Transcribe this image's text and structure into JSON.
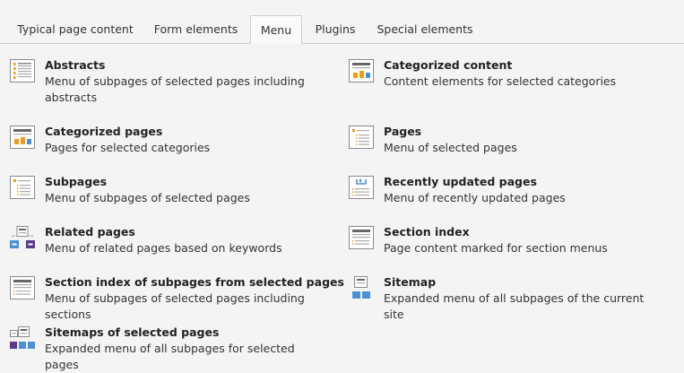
{
  "tabs": [
    {
      "label": "Typical page content"
    },
    {
      "label": "Form elements"
    },
    {
      "label": "Menu"
    },
    {
      "label": "Plugins"
    },
    {
      "label": "Special elements"
    }
  ],
  "active_tab": "Menu",
  "items": [
    {
      "title": "Abstracts",
      "desc": "Menu of subpages of selected pages including abstracts",
      "icon": "menu-abstracts-icon"
    },
    {
      "title": "Categorized content",
      "desc": "Content elements for selected categories",
      "icon": "categorized-content-icon"
    },
    {
      "title": "Categorized pages",
      "desc": "Pages for selected categories",
      "icon": "categorized-pages-icon"
    },
    {
      "title": "Pages",
      "desc": "Menu of selected pages",
      "icon": "menu-pages-icon"
    },
    {
      "title": "Subpages",
      "desc": "Menu of subpages of selected pages",
      "icon": "menu-subpages-icon"
    },
    {
      "title": "Recently updated pages",
      "desc": "Menu of recently updated pages",
      "icon": "recently-updated-icon"
    },
    {
      "title": "Related pages",
      "desc": "Menu of related pages based on keywords",
      "icon": "related-pages-icon"
    },
    {
      "title": "Section index",
      "desc": "Page content marked for section menus",
      "icon": "section-index-icon"
    },
    {
      "title": "Section index of subpages from selected pages",
      "desc": "Menu of subpages of selected pages including sections",
      "icon": "section-index-subpages-icon"
    },
    {
      "title": "Sitemap",
      "desc": "Expanded menu of all subpages of the current site",
      "icon": "sitemap-icon"
    },
    {
      "title": "Sitemaps of selected pages",
      "desc": "Expanded menu of all subpages for selected pages",
      "icon": "sitemaps-selected-icon"
    }
  ],
  "colors": {
    "accent_orange": "#f39c12",
    "accent_blue": "#4a90d9",
    "accent_purple": "#5b3a8c",
    "icon_border": "#8a8a8a"
  }
}
